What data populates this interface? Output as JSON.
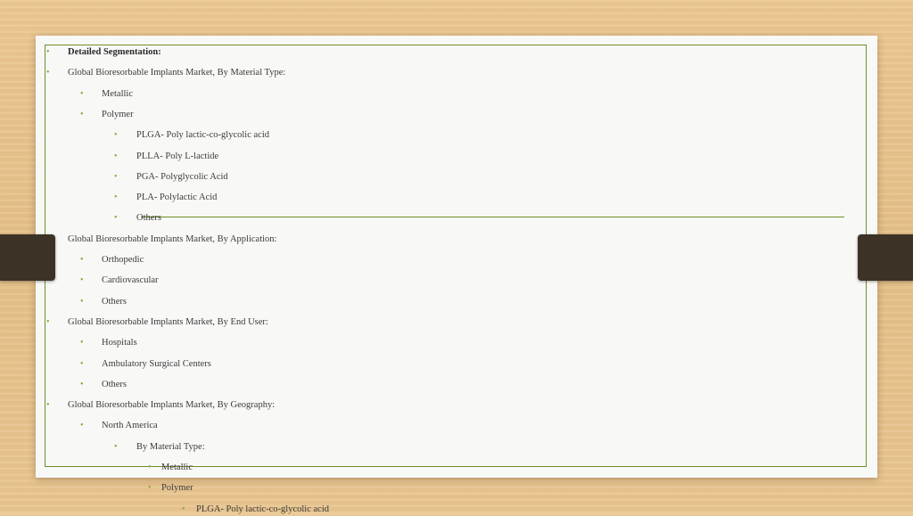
{
  "items": [
    {
      "text": "Detailed Segmentation:",
      "level": 0,
      "bold": true
    },
    {
      "text": "Global Bioresorbable Implants Market, By Material Type:",
      "level": 0
    },
    {
      "text": "Metallic",
      "level": 1
    },
    {
      "text": "Polymer",
      "level": 1
    },
    {
      "text": "PLGA- Poly lactic-co-glycolic acid",
      "level": 2
    },
    {
      "text": "PLLA- Poly L-lactide",
      "level": 2
    },
    {
      "text": "PGA- Polyglycolic Acid",
      "level": 2
    },
    {
      "text": "PLA- Polylactic Acid",
      "level": 2
    },
    {
      "text": "Others",
      "level": 2
    },
    {
      "text": "Global Bioresorbable Implants Market, By Application:",
      "level": 0
    },
    {
      "text": "Orthopedic",
      "level": 1
    },
    {
      "text": "Cardiovascular",
      "level": 1
    },
    {
      "text": "Others",
      "level": 1
    },
    {
      "text": "Global Bioresorbable Implants Market, By End User:",
      "level": 0
    },
    {
      "text": "Hospitals",
      "level": 1
    },
    {
      "text": "Ambulatory Surgical Centers",
      "level": 1
    },
    {
      "text": "Others",
      "level": 1
    },
    {
      "text": "Global Bioresorbable Implants Market, By Geography:",
      "level": 0
    },
    {
      "text": "North America",
      "level": 1
    },
    {
      "text": "By Material Type:",
      "level": 2
    },
    {
      "text": "Metallic",
      "level": 3
    },
    {
      "text": "Polymer",
      "level": 3
    },
    {
      "text": "PLGA- Poly lactic-co-glycolic acid",
      "level": 4
    }
  ],
  "bullet_glyph": "•",
  "colors": {
    "accent": "#6f8d2a",
    "bullet": "#8aa83a",
    "text": "#3b3b3b",
    "tab": "#3c3226"
  }
}
